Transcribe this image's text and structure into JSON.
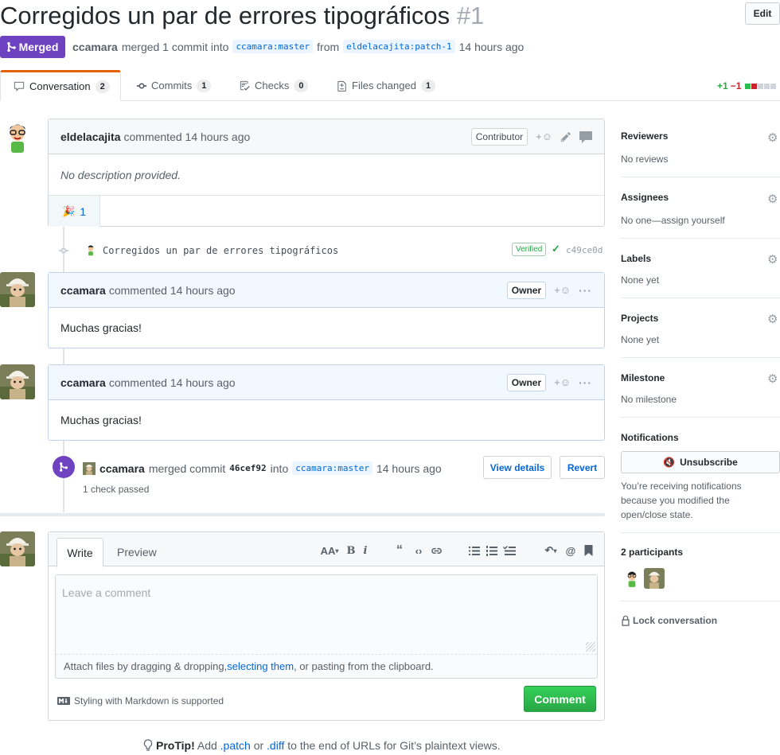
{
  "header": {
    "title": "Corregidos un par de errores tipográficos",
    "number": "#1",
    "edit_label": "Edit",
    "state_label": "Merged",
    "author": "ccamara",
    "merge_text": "merged 1 commit into",
    "base_branch": "ccamara:master",
    "from_text": "from",
    "head_branch": "eldelacajita:patch-1",
    "time": "14 hours ago"
  },
  "tabs": [
    {
      "label": "Conversation",
      "count": "2",
      "icon": "comment-icon"
    },
    {
      "label": "Commits",
      "count": "1",
      "icon": "commit-icon"
    },
    {
      "label": "Checks",
      "count": "0",
      "icon": "checklist-icon"
    },
    {
      "label": "Files changed",
      "count": "1",
      "icon": "file-diff-icon"
    }
  ],
  "diffstat": {
    "additions": "+1",
    "deletions": "−1"
  },
  "first_comment": {
    "author": "eldelacajita",
    "text": "commented 14 hours ago",
    "badge": "Contributor",
    "body": "No description provided.",
    "reaction_emoji": "🎉",
    "reaction_count": "1"
  },
  "commit": {
    "message": "Corregidos un par de errores tipográficos",
    "verified": "Verified",
    "sha": "c49ce0d"
  },
  "comments": [
    {
      "author": "ccamara",
      "text": "commented 14 hours ago",
      "badge": "Owner",
      "body": "Muchas gracias!"
    },
    {
      "author": "ccamara",
      "text": "commented 14 hours ago",
      "badge": "Owner",
      "body": "Muchas gracias!"
    }
  ],
  "merge_event": {
    "author": "ccamara",
    "text": "merged commit",
    "sha": "46cef92",
    "into": "into",
    "branch": "ccamara:master",
    "time": "14 hours ago",
    "checks": "1 check passed",
    "view_details": "View details",
    "revert": "Revert"
  },
  "editor": {
    "write_tab": "Write",
    "preview_tab": "Preview",
    "placeholder": "Leave a comment",
    "attach_pre": "Attach files by dragging & dropping, ",
    "attach_link": "selecting them",
    "attach_post": ", or pasting from the clipboard.",
    "markdown_note": "Styling with Markdown is supported",
    "submit": "Comment"
  },
  "protip": {
    "label": "ProTip!",
    "pre": " Add ",
    "patch": ".patch",
    "or": " or ",
    "diff": ".diff",
    "post": " to the end of URLs for Git’s plaintext views."
  },
  "sidebar": {
    "reviewers": {
      "title": "Reviewers",
      "value": "No reviews"
    },
    "assignees": {
      "title": "Assignees",
      "value": "No one—assign yourself"
    },
    "labels": {
      "title": "Labels",
      "value": "None yet"
    },
    "projects": {
      "title": "Projects",
      "value": "None yet"
    },
    "milestone": {
      "title": "Milestone",
      "value": "No milestone"
    },
    "notifications": {
      "title": "Notifications",
      "button": "Unsubscribe",
      "reason": "You’re receiving notifications because you modified the open/close state."
    },
    "participants": "2 participants",
    "lock": "Lock conversation"
  },
  "colors": {
    "merged": "#6f42c1",
    "link": "#0366d6",
    "success": "#28a745",
    "danger": "#cb2431"
  }
}
